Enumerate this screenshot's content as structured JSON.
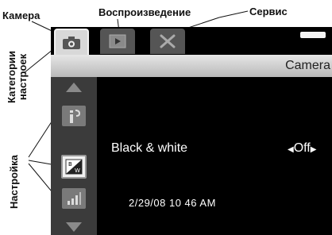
{
  "callouts": {
    "camera": "Камера",
    "playback": "Воспроизведение",
    "service": "Сервис",
    "categories_line1": "Категории",
    "categories_line2": "настроек",
    "settings": "Настройка"
  },
  "screen": {
    "header_title": "Camera",
    "tabs": [
      {
        "name": "camera",
        "icon": "camera-icon",
        "selected": true
      },
      {
        "name": "playback",
        "icon": "play-icon",
        "selected": false
      },
      {
        "name": "service",
        "icon": "tools-icon",
        "selected": false
      }
    ],
    "side_icons": [
      "arrow-up-icon",
      "info-icon",
      "black-white-icon",
      "signal-bars-icon",
      "arrow-down-icon"
    ],
    "setting": {
      "label": "Black & white",
      "value": "Off"
    },
    "timestamp": "2/29/08 10 46 AM"
  },
  "colors": {
    "screen_bg": "#000000",
    "header_bg": "#d0d0d0",
    "panel_bg": "#3b3b3b"
  }
}
